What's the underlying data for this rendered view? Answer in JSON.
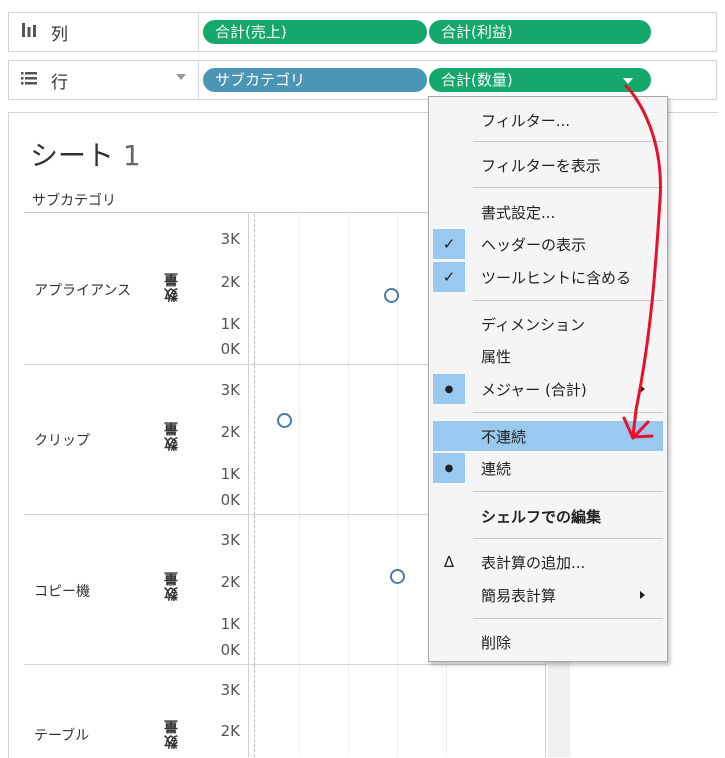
{
  "shelves": {
    "columns": {
      "label": "列",
      "icon": "columns-icon",
      "pills": [
        "合計(売上)",
        "合計(利益)"
      ]
    },
    "rows": {
      "label": "行",
      "icon": "rows-icon",
      "pills": [
        "サブカテゴリ",
        "合計(数量)"
      ]
    }
  },
  "sheet": {
    "title": "シート",
    "title_num": "1",
    "column_header": "サブカテゴリ",
    "axis_title": "数量",
    "panels": [
      {
        "category": "アプライアンス",
        "ticks": [
          "3K",
          "2K",
          "1K",
          "0K"
        ]
      },
      {
        "category": "クリップ",
        "ticks": [
          "3K",
          "2K",
          "1K",
          "0K"
        ]
      },
      {
        "category": "コピー機",
        "ticks": [
          "3K",
          "2K",
          "1K",
          "0K"
        ]
      },
      {
        "category": "テーブル",
        "ticks": [
          "3K",
          "2K"
        ]
      }
    ]
  },
  "menu": {
    "items": {
      "filter": "フィルター...",
      "show_filter": "フィルターを表示",
      "format": "書式設定...",
      "show_header": "ヘッダーの表示",
      "include_tooltip": "ツールヒントに含める",
      "dimension": "ディメンション",
      "attribute": "属性",
      "measure": "メジャー (合計)",
      "discrete": "不連続",
      "continuous": "連続",
      "edit_shelf": "シェルフでの編集",
      "add_table_calc": "表計算の追加...",
      "quick_table_calc": "簡易表計算",
      "remove": "削除"
    },
    "marks": {
      "check": "✓",
      "bullet": "●",
      "delta": "Δ"
    }
  },
  "colors": {
    "pill_green": "#14a86a",
    "pill_blue": "#4b95b5",
    "menu_highlight": "#99c9ee",
    "annotation": "#e8102a",
    "point": "#4e79a7"
  }
}
